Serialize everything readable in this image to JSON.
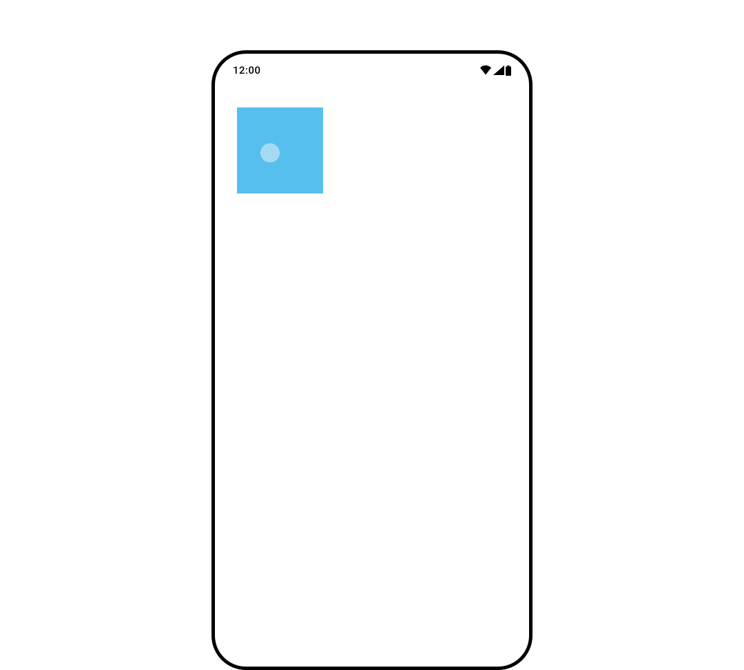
{
  "status_bar": {
    "time": "12:00"
  },
  "colors": {
    "square": "#56bfee",
    "touch_dot": "#a6daf4",
    "frame": "#000000"
  }
}
